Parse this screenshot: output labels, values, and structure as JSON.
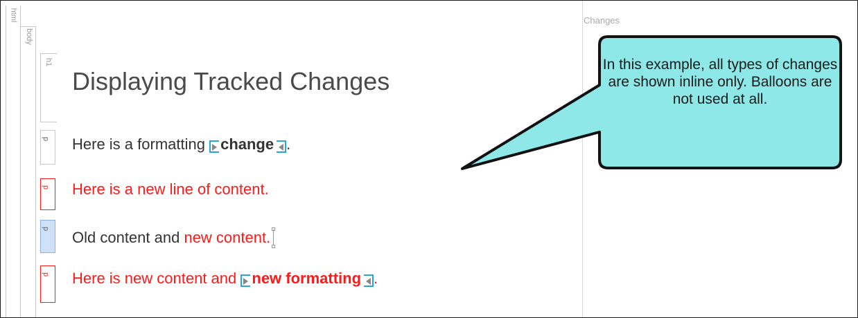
{
  "structure_bar": {
    "html_label": "html",
    "body_label": "body",
    "h1_label": "h1",
    "p_labels": [
      "p",
      "p",
      "p",
      "p"
    ]
  },
  "changes_pane": {
    "label": "Changes"
  },
  "document": {
    "heading": "Displaying Tracked Changes",
    "para1": {
      "prefix": "Here is a formatting ",
      "formatted": "change",
      "suffix": "."
    },
    "para2": {
      "text": "Here is a new line of content."
    },
    "para3": {
      "old": "Old content and ",
      "inserted": "new content."
    },
    "para4": {
      "prefix": "Here is new content and ",
      "formatted": "new formatting",
      "suffix": "."
    }
  },
  "callout": {
    "text": "In this example, all types of changes are shown inline only. Balloons are not used at all."
  },
  "colors": {
    "inserted_text": "#ff1a1a",
    "change_marker": "#2aa2e6",
    "callout_fill": "#8ee8e8",
    "selected_tag": "#cfe0f7"
  },
  "icons": [
    "change-start-marker-icon",
    "change-end-marker-icon",
    "insertion-cursor-icon"
  ]
}
